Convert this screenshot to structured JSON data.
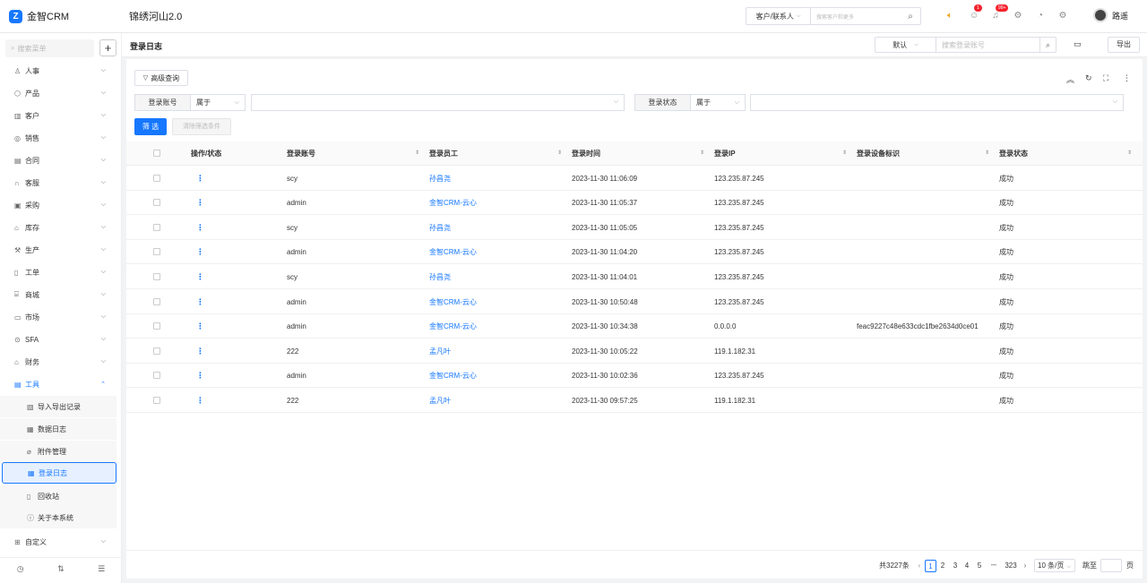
{
  "app": {
    "logo_mark": "Z",
    "name": "金智CRM",
    "company": "锦绣河山2.0"
  },
  "top": {
    "search_scope": "客户/联系人",
    "search_placeholder": "搜索客户和更多",
    "badge_contacts": "1",
    "badge_notify": "99+",
    "user_name": "路遥"
  },
  "sidebar": {
    "search_placeholder": "搜索菜单",
    "items": [
      {
        "label": "人事",
        "icon": "person-icon"
      },
      {
        "label": "产品",
        "icon": "box-icon"
      },
      {
        "label": "客户",
        "icon": "customer-icon"
      },
      {
        "label": "销售",
        "icon": "sales-icon"
      },
      {
        "label": "合同",
        "icon": "contract-icon"
      },
      {
        "label": "客服",
        "icon": "headset-icon"
      },
      {
        "label": "采购",
        "icon": "cart-icon"
      },
      {
        "label": "库存",
        "icon": "warehouse-icon"
      },
      {
        "label": "生产",
        "icon": "factory-icon"
      },
      {
        "label": "工单",
        "icon": "ticket-icon"
      },
      {
        "label": "商城",
        "icon": "shop-icon"
      },
      {
        "label": "市场",
        "icon": "market-icon"
      },
      {
        "label": "SFA",
        "icon": "sfa-icon"
      },
      {
        "label": "财务",
        "icon": "finance-icon"
      },
      {
        "label": "工具",
        "icon": "tools-icon"
      }
    ],
    "tools_children": [
      {
        "label": "导入导出记录"
      },
      {
        "label": "数据日志"
      },
      {
        "label": "附件管理"
      },
      {
        "label": "登录日志"
      },
      {
        "label": "回收站"
      },
      {
        "label": "关于本系统"
      }
    ],
    "custom_label": "自定义"
  },
  "page": {
    "title": "登录日志",
    "view_select": "默认",
    "search_placeholder": "搜索登录账号",
    "export_label": "导出"
  },
  "filters": {
    "advanced_label": "高级查询",
    "account_label": "登录账号",
    "account_op": "属于",
    "status_label": "登录状态",
    "status_op": "属于",
    "filter_button": "筛 选",
    "clear_button": "清除筛选条件"
  },
  "table": {
    "columns": [
      "操作/状态",
      "登录账号",
      "登录员工",
      "登录时间",
      "登录IP",
      "登录设备标识",
      "登录状态"
    ],
    "rows": [
      {
        "account": "scy",
        "employee": "孙昌尧",
        "time": "2023-11-30 11:06:09",
        "ip": "123.235.87.245",
        "device": "",
        "status": "成功"
      },
      {
        "account": "admin",
        "employee": "金智CRM-云心",
        "time": "2023-11-30 11:05:37",
        "ip": "123.235.87.245",
        "device": "",
        "status": "成功"
      },
      {
        "account": "scy",
        "employee": "孙昌尧",
        "time": "2023-11-30 11:05:05",
        "ip": "123.235.87.245",
        "device": "",
        "status": "成功"
      },
      {
        "account": "admin",
        "employee": "金智CRM-云心",
        "time": "2023-11-30 11:04:20",
        "ip": "123.235.87.245",
        "device": "",
        "status": "成功"
      },
      {
        "account": "scy",
        "employee": "孙昌尧",
        "time": "2023-11-30 11:04:01",
        "ip": "123.235.87.245",
        "device": "",
        "status": "成功"
      },
      {
        "account": "admin",
        "employee": "金智CRM-云心",
        "time": "2023-11-30 10:50:48",
        "ip": "123.235.87.245",
        "device": "",
        "status": "成功"
      },
      {
        "account": "admin",
        "employee": "金智CRM-云心",
        "time": "2023-11-30 10:34:38",
        "ip": "0.0.0.0",
        "device": "feac9227c48e633cdc1fbe2634d0ce01",
        "status": "成功"
      },
      {
        "account": "222",
        "employee": "孟凡叶",
        "time": "2023-11-30 10:05:22",
        "ip": "119.1.182.31",
        "device": "",
        "status": "成功"
      },
      {
        "account": "admin",
        "employee": "金智CRM-云心",
        "time": "2023-11-30 10:02:36",
        "ip": "123.235.87.245",
        "device": "",
        "status": "成功"
      },
      {
        "account": "222",
        "employee": "孟凡叶",
        "time": "2023-11-30 09:57:25",
        "ip": "119.1.182.31",
        "device": "",
        "status": "成功"
      }
    ]
  },
  "pagination": {
    "total": "共3227条",
    "pages": [
      "1",
      "2",
      "3",
      "4",
      "5"
    ],
    "ellipsis": "•••",
    "last": "323",
    "page_size": "10 条/页",
    "jump_label": "跳至",
    "page_unit": "页"
  },
  "colors": {
    "accent": "#1677ff",
    "badge": "#f5222d",
    "speaker": "#f5a623"
  }
}
